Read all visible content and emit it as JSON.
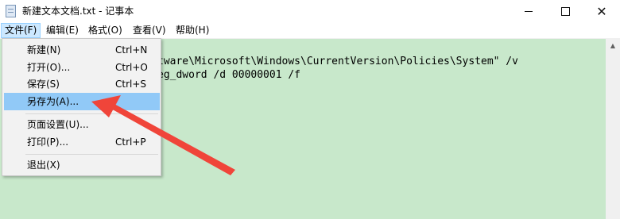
{
  "window": {
    "title": "新建文本文档.txt - 记事本",
    "minimize_symbol": "—",
    "maximize_symbol": "☐",
    "close_symbol": "✕"
  },
  "menubar": {
    "items": [
      "文件(F)",
      "编辑(E)",
      "格式(O)",
      "查看(V)",
      "帮助(H)"
    ],
    "active": "文件(F)"
  },
  "file_menu": {
    "items": [
      {
        "label": "新建(N)",
        "shortcut": "Ctrl+N"
      },
      {
        "label": "打开(O)...",
        "shortcut": "Ctrl+O"
      },
      {
        "label": "保存(S)",
        "shortcut": "Ctrl+S"
      },
      {
        "label": "另存为(A)...",
        "shortcut": ""
      },
      {
        "label": "页面设置(U)...",
        "shortcut": ""
      },
      {
        "label": "打印(P)...",
        "shortcut": "Ctrl+P"
      },
      {
        "label": "退出(X)",
        "shortcut": ""
      }
    ],
    "highlighted": "另存为(A)..."
  },
  "editor": {
    "line1": "tware\\Microsoft\\Windows\\CurrentVersion\\Policies\\System\" /v",
    "line2": "eg_dword /d 00000001 /f",
    "background": "#c8e8cb"
  },
  "annotation": {
    "arrow_color": "#f0453a"
  }
}
